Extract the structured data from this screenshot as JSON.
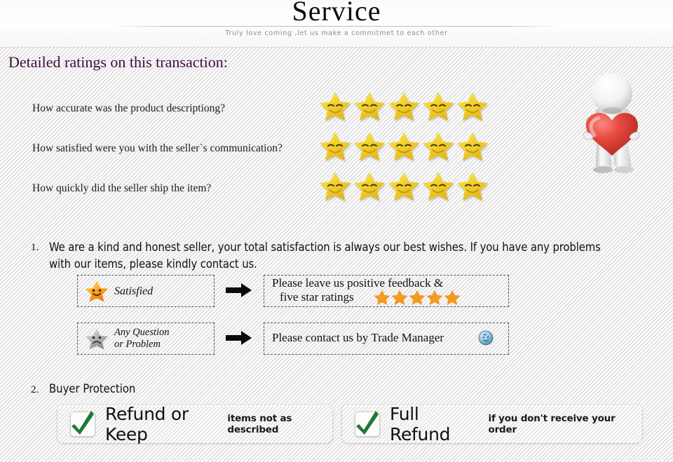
{
  "header": {
    "title": "Service",
    "subtitle": "Truly love coming ,let us make a commitmet to each other"
  },
  "section": {
    "title": "Detailed ratings on this transaction:"
  },
  "ratings": {
    "rows": [
      {
        "question": "How accurate was the product descriptiong?",
        "stars": 5,
        "max": 5
      },
      {
        "question": "How satisfied were you with the seller`s communication?",
        "stars": 5,
        "max": 5
      },
      {
        "question": "How quickly did the seller ship the item?",
        "stars": 5,
        "max": 5
      }
    ]
  },
  "points": [
    {
      "number": "1.",
      "text": "We are a kind and honest seller, your total satisfaction is always our best wishes. If you have any problems with our items, please kindly contact us."
    },
    {
      "number": "2.",
      "text": "Buyer Protection"
    }
  ],
  "flow": {
    "row1": {
      "left_label": "Satisfied",
      "left_icon": "happy-star-icon",
      "arrow_icon": "right-arrow-icon",
      "right_line1": "Please leave us positive feedback &",
      "right_line2": "five star ratings",
      "right_stars": 5
    },
    "row2": {
      "left_label_line1": "Any Question",
      "left_label_line2": "or Problem",
      "left_icon": "sad-star-icon",
      "arrow_icon": "right-arrow-icon",
      "right_line1": "Please contact us by Trade Manager",
      "right_icon": "trade-manager-icon"
    }
  },
  "protection": {
    "buttons": [
      {
        "icon": "green-check-icon",
        "main": "Refund or Keep",
        "sub": "items not as described"
      },
      {
        "icon": "green-check-icon",
        "main": "Full Refund",
        "sub": "if you don't receive your order"
      }
    ]
  },
  "mascot": {
    "icon": "3d-figure-holding-heart-icon"
  },
  "colors": {
    "heading": "#3b0b3b",
    "star_yellow": "#f2d33a",
    "star_orange": "#f5a623",
    "check_green": "#1e7a36",
    "heart_red": "#e03a34"
  }
}
